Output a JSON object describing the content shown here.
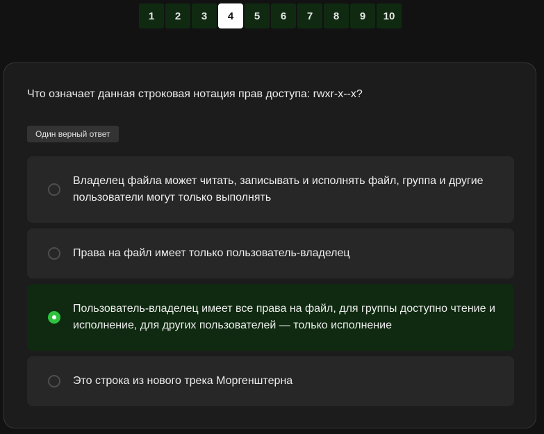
{
  "pager": {
    "pages": [
      "1",
      "2",
      "3",
      "4",
      "5",
      "6",
      "7",
      "8",
      "9",
      "10"
    ],
    "current": "4"
  },
  "question": {
    "text": "Что означает данная строковая нотация прав доступа: rwxr-x--x?",
    "badge": "Один верный ответ"
  },
  "options": [
    {
      "text": "Владелец файла может читать, записывать и исполнять файл, группа и другие пользователи могут только выполнять",
      "selected": false
    },
    {
      "text": "Права на файл имеет только пользователь-владелец",
      "selected": false
    },
    {
      "text": "Пользователь-владелец имеет все права на файл, для группы доступно чтение и исполнение, для других пользователей — только исполнение",
      "selected": true
    },
    {
      "text": "Это строка из нового трека Моргенштерна",
      "selected": false
    }
  ],
  "colors": {
    "page_bg": "#121212",
    "card_bg": "#1c1c1c",
    "pager_bg": "#102a12",
    "option_bg": "#272727",
    "selected_bg": "#0f2a10",
    "accent_green": "#2fc23f"
  }
}
